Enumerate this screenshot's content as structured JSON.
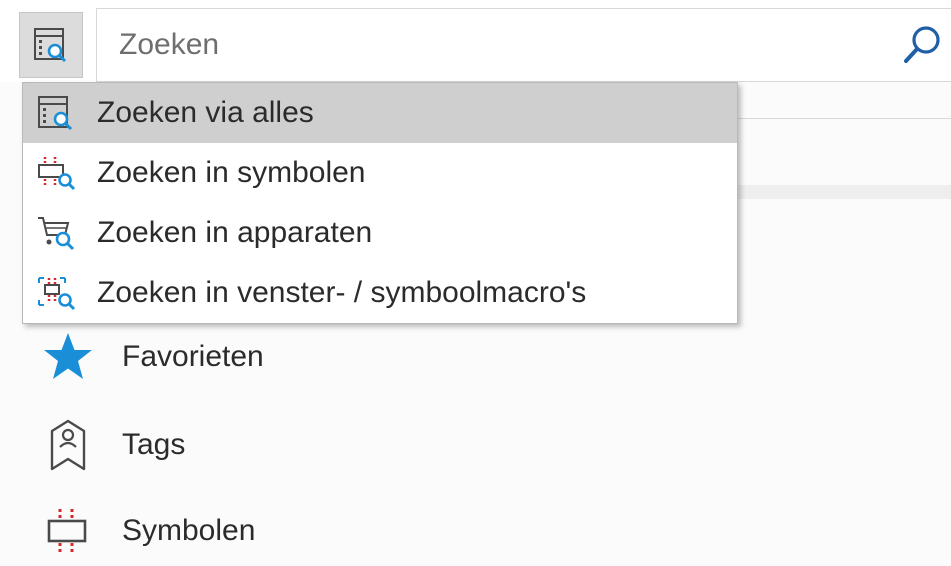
{
  "search": {
    "placeholder": "Zoeken"
  },
  "icons": {
    "scope": "search-scope-icon",
    "search": "magnifier-icon"
  },
  "dropdown": {
    "items": [
      {
        "label": "Zoeken via alles",
        "icon": "search-all-icon",
        "selected": true
      },
      {
        "label": "Zoeken in symbolen",
        "icon": "search-symbols-icon",
        "selected": false
      },
      {
        "label": "Zoeken in apparaten",
        "icon": "search-devices-icon",
        "selected": false
      },
      {
        "label": "Zoeken in venster- / symboolmacro's",
        "icon": "search-macros-icon",
        "selected": false
      }
    ]
  },
  "nav": {
    "items": [
      {
        "label": "Favorieten",
        "icon": "star-icon"
      },
      {
        "label": "Tags",
        "icon": "tag-icon"
      },
      {
        "label": "Symbolen",
        "icon": "symbol-icon"
      }
    ]
  },
  "colors": {
    "accent": "#1a8fd8",
    "symbol_red": "#d9262a",
    "selected_bg": "#cfcfcf"
  }
}
